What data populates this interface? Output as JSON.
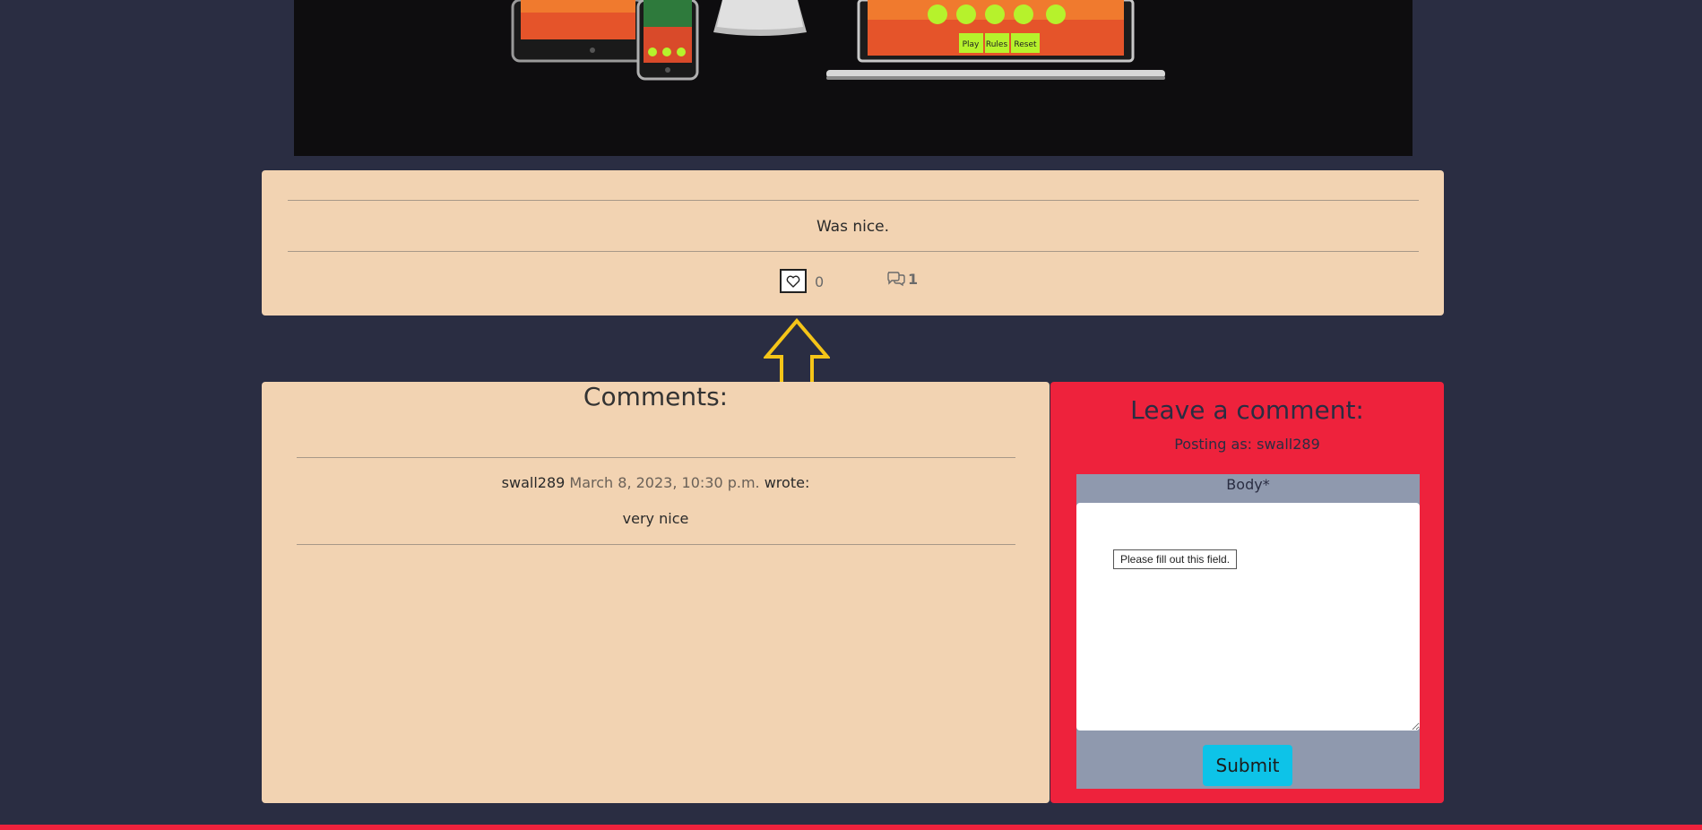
{
  "post": {
    "text": "Was nice.",
    "likes": "0",
    "comment_count": "1"
  },
  "comments": {
    "title": "Comments:",
    "items": [
      {
        "author": "swall289",
        "date": "March 8, 2023, 10:30 p.m.",
        "suffix": "wrote:",
        "body": "very nice"
      }
    ]
  },
  "form": {
    "title": "Leave a comment:",
    "posting_as": "Posting as: swall289",
    "body_label": "Body*",
    "tooltip": "Please fill out this field.",
    "submit_label": "Submit"
  },
  "hero_screen": {
    "buttons": [
      "Play",
      "Rules",
      "Reset"
    ]
  },
  "colors": {
    "background": "#2a2d42",
    "card": "#f2d3b2",
    "accent": "#ee223c",
    "form_panel": "#8f99ae",
    "submit": "#0dc3e8",
    "arrow": "#f5c518"
  }
}
